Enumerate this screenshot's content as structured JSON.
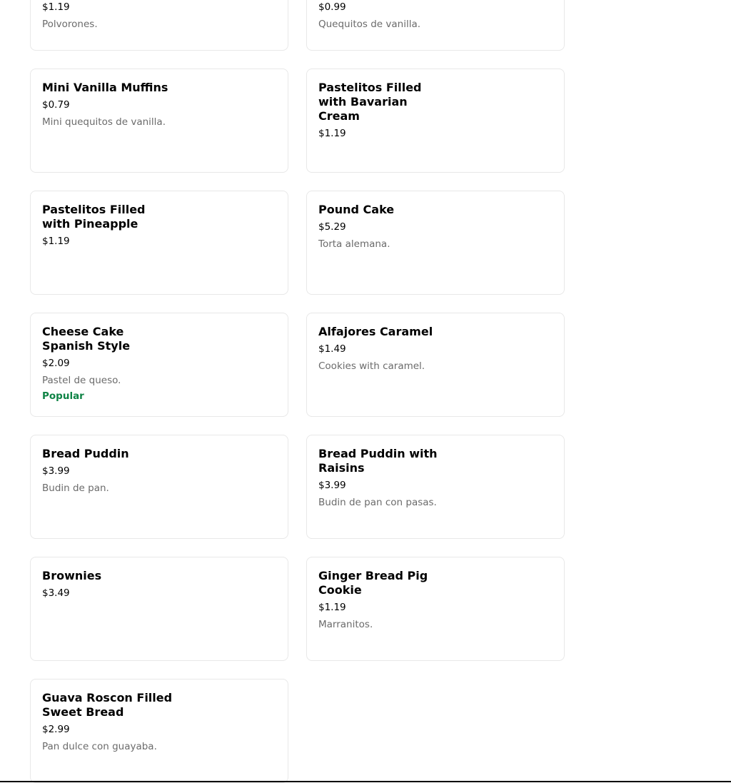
{
  "menu": {
    "items": [
      {
        "name": "",
        "price": "$1.19",
        "description": "Polvorones.",
        "badge": ""
      },
      {
        "name": "",
        "price": "$0.99",
        "description": "Quequitos de vanilla.",
        "badge": ""
      },
      {
        "name": "Mini Vanilla Muffins",
        "price": "$0.79",
        "description": "Mini quequitos de vanilla.",
        "badge": ""
      },
      {
        "name": "Pastelitos Filled with Bavarian Cream",
        "price": "$1.19",
        "description": "",
        "badge": ""
      },
      {
        "name": "Pastelitos Filled with Pineapple",
        "price": "$1.19",
        "description": "",
        "badge": ""
      },
      {
        "name": "Pound Cake",
        "price": "$5.29",
        "description": "Torta alemana.",
        "badge": ""
      },
      {
        "name": "Cheese Cake Spanish Style",
        "price": "$2.09",
        "description": "Pastel de queso.",
        "badge": "Popular"
      },
      {
        "name": "Alfajores Caramel",
        "price": "$1.49",
        "description": "Cookies with caramel.",
        "badge": ""
      },
      {
        "name": "Bread Puddin",
        "price": "$3.99",
        "description": "Budin de pan.",
        "badge": ""
      },
      {
        "name": "Bread Puddin with Raisins",
        "price": "$3.99",
        "description": "Budin de pan con pasas.",
        "badge": ""
      },
      {
        "name": "Brownies",
        "price": "$3.49",
        "description": "",
        "badge": ""
      },
      {
        "name": "Ginger Bread Pig Cookie",
        "price": "$1.19",
        "description": "Marranitos.",
        "badge": ""
      },
      {
        "name": "Guava Roscon Filled Sweet Bread",
        "price": "$2.99",
        "description": "Pan dulce con guayaba.",
        "badge": ""
      }
    ]
  },
  "colors": {
    "badge": "#0e8345",
    "description": "#6b6b6b",
    "card_border": "#e8e8e8"
  }
}
